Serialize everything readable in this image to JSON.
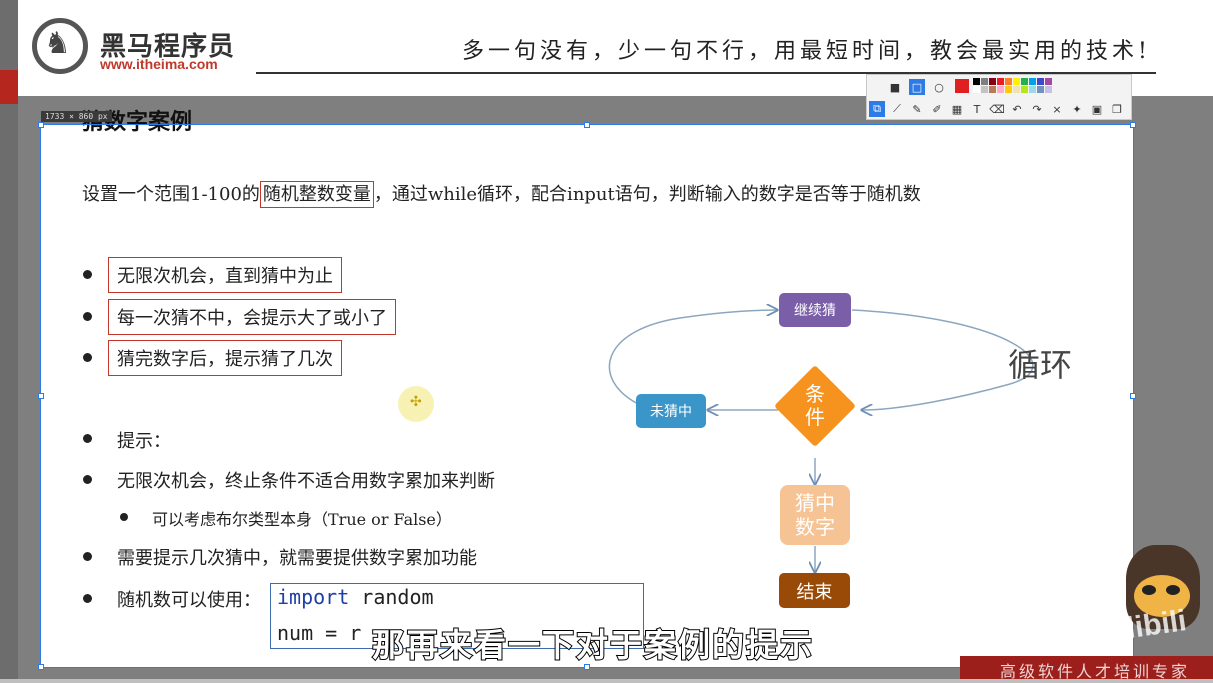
{
  "header": {
    "brand_name": "黑马程序员",
    "brand_url": "www.itheima.com",
    "slogan": "多一句没有，少一句不行，用最短时间，教会最实用的技术!"
  },
  "selection": {
    "size_label": "1733 × 860  px"
  },
  "slide": {
    "title": "猜数字案例",
    "intro": {
      "part1": "设置一个范围1-100的",
      "boxed": "随机整数变量",
      "part2": "，通过while循环，配合input语句，判断输入的数字是否等于随机数"
    },
    "requirements": [
      "无限次机会，直到猜中为止",
      "每一次猜不中，会提示大了或小了",
      "猜完数字后，提示猜了几次"
    ],
    "hints": {
      "heading": "提示：",
      "item1": "无限次机会，终止条件不适合用数字累加来判断",
      "sub1": "可以考虑布尔类型本身（True or False）",
      "item2": "需要提示几次猜中，就需要提供数字累加功能",
      "item3": "随机数可以使用："
    },
    "code": {
      "line1_kw": "import",
      "line1_rest": " random",
      "line2": "num = r"
    }
  },
  "flowchart": {
    "continue": "继续猜",
    "miss": "未猜中",
    "condition_line1": "条",
    "condition_line2": "件",
    "hit_line1": "猜中",
    "hit_line2": "数字",
    "end": "结束",
    "loop_label": "循环",
    "colors": {
      "continue": "#7a5fa8",
      "miss": "#3a95c9",
      "condition": "#f5931e",
      "hit": "#f6c494",
      "end": "#9a4a07"
    }
  },
  "toolbar": {
    "row1": [
      "rect-fill-icon",
      "rect-icon",
      "ellipse-icon"
    ],
    "row2": [
      "screenshot-icon",
      "polyline-icon",
      "pen-icon",
      "marker-icon",
      "mosaic-icon",
      "text-icon",
      "eraser-icon",
      "undo-icon",
      "redo-icon",
      "close-icon",
      "pin-icon",
      "save-icon",
      "copy-icon"
    ],
    "row2_glyphs": [
      "⧉",
      "⟋",
      "✎",
      "✐",
      "▦",
      "T",
      "⌫",
      "↶",
      "↷",
      "×",
      "✦",
      "▣",
      "❐"
    ],
    "active_color": "#e02020",
    "palette": [
      "#000000",
      "#7f7f7f",
      "#880015",
      "#ed1c24",
      "#ff7f27",
      "#fff200",
      "#22b14c",
      "#00a2e8",
      "#3f48cc",
      "#a349a4",
      "#ffffff",
      "#c3c3c3",
      "#b97a57",
      "#ffaec9",
      "#ffc90e",
      "#efe4b0",
      "#b5e61d",
      "#99d9ea",
      "#7092be",
      "#c8bfe7"
    ]
  },
  "subtitle": "那再来看一下对于案例的提示",
  "footer": {
    "text": "高级软件人才培训专家",
    "watermark": "bilibili"
  }
}
